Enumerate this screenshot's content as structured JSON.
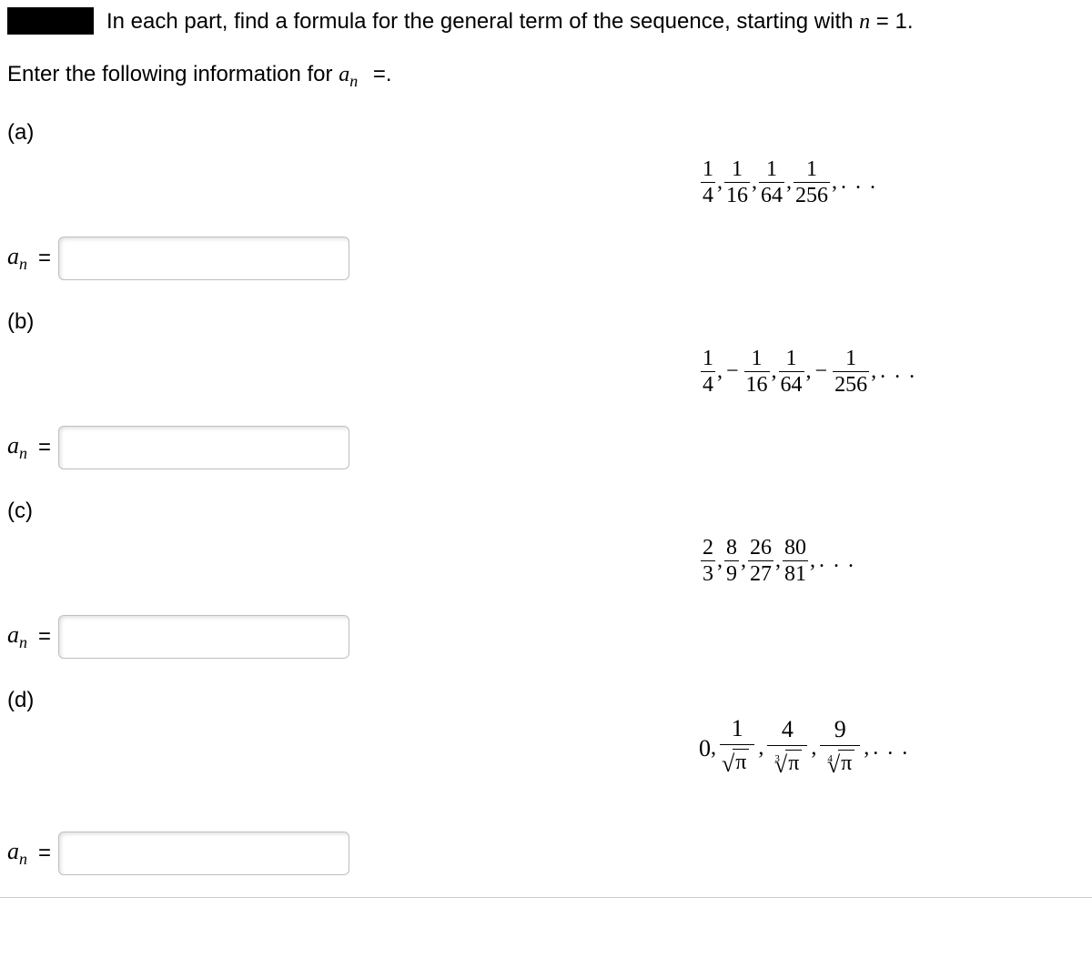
{
  "instructions": "In each part, find a formula for the general term of the sequence, starting with ",
  "instructions_tail": " = 1.",
  "n_var": "n",
  "enter_prefix": "Enter the following information for ",
  "enter_suffix": " =.",
  "an_symbol_a": "a",
  "an_symbol_n": "n",
  "eq_sign": "=",
  "parts": {
    "a": {
      "label": "(a)"
    },
    "b": {
      "label": "(b)"
    },
    "c": {
      "label": "(c)"
    },
    "d": {
      "label": "(d)"
    }
  },
  "sequences": {
    "a": {
      "terms": [
        {
          "num": "1",
          "den": "4"
        },
        {
          "num": "1",
          "den": "16"
        },
        {
          "num": "1",
          "den": "64"
        },
        {
          "num": "1",
          "den": "256"
        }
      ]
    },
    "b": {
      "terms": [
        {
          "sign": "",
          "num": "1",
          "den": "4"
        },
        {
          "sign": "−",
          "num": "1",
          "den": "16"
        },
        {
          "sign": "",
          "num": "1",
          "den": "64"
        },
        {
          "sign": "−",
          "num": "1",
          "den": "256"
        }
      ]
    },
    "c": {
      "terms": [
        {
          "num": "2",
          "den": "3"
        },
        {
          "num": "8",
          "den": "9"
        },
        {
          "num": "26",
          "den": "27"
        },
        {
          "num": "80",
          "den": "81"
        }
      ]
    },
    "d": {
      "leading": "0",
      "terms": [
        {
          "num": "1",
          "root_deg": "",
          "radicand": "π"
        },
        {
          "num": "4",
          "root_deg": "3",
          "radicand": "π"
        },
        {
          "num": "9",
          "root_deg": "4",
          "radicand": "π"
        }
      ]
    }
  },
  "sep": ",",
  "dots": ". . .",
  "inputs": {
    "a": "",
    "b": "",
    "c": "",
    "d": ""
  }
}
